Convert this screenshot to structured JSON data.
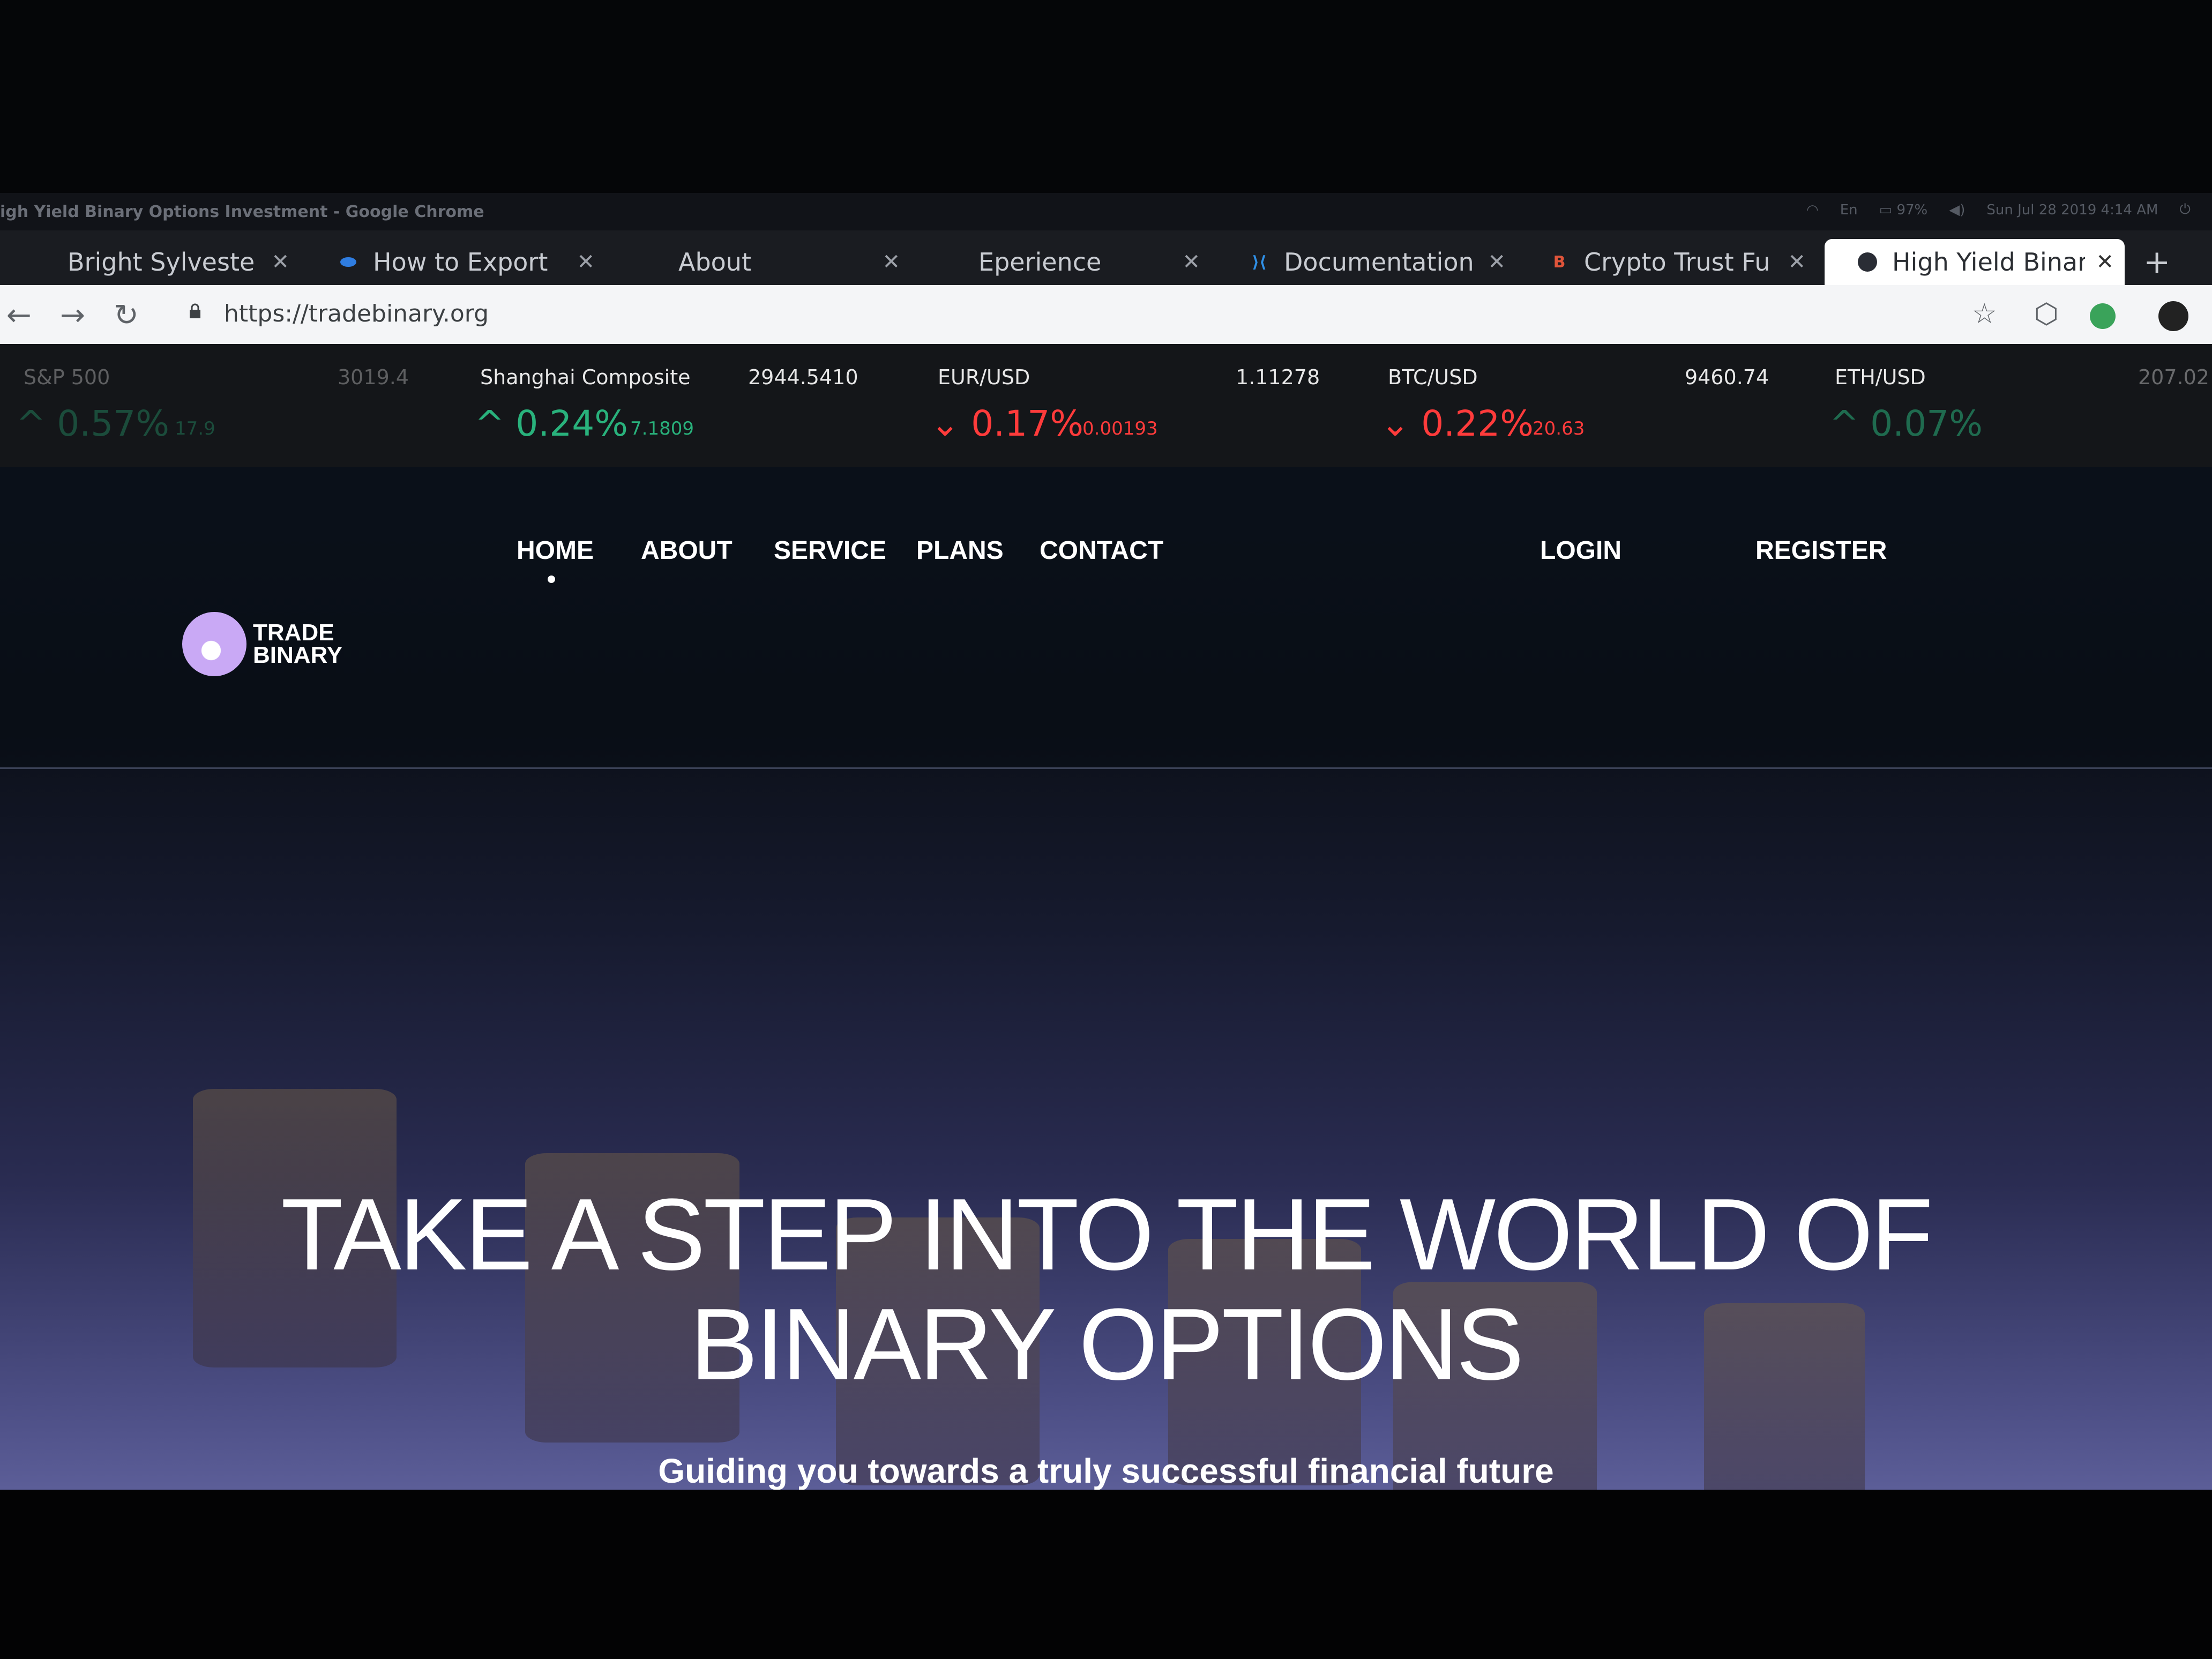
{
  "os": {
    "window_title": "igh Yield Binary Options Investment - Google Chrome",
    "clock": "Sun Jul 28 2019 4:14 AM",
    "battery": "97%"
  },
  "tabs": [
    {
      "title": "Bright Sylveste",
      "favicon": "none",
      "active": false
    },
    {
      "title": "How to Export",
      "favicon": "blue-dot",
      "active": false
    },
    {
      "title": "About",
      "favicon": "none",
      "active": false
    },
    {
      "title": "Eperience",
      "favicon": "none",
      "active": false
    },
    {
      "title": "Documentation",
      "favicon": "vscode-icon",
      "active": false
    },
    {
      "title": "Crypto Trust Fu",
      "favicon": "b-icon",
      "active": false
    },
    {
      "title": "High Yield Binar",
      "favicon": "site-icon",
      "active": true
    }
  ],
  "browser": {
    "url": "https://tradebinary.org"
  },
  "ticker": [
    {
      "symbol": "S&P 500",
      "price": "3019.4",
      "pct": "0.57%",
      "change": "17.9",
      "direction": "up"
    },
    {
      "symbol": "Shanghai Composite",
      "price": "2944.5410",
      "pct": "0.24%",
      "change": "7.1809",
      "direction": "up"
    },
    {
      "symbol": "EUR/USD",
      "price": "1.11278",
      "pct": "0.17%",
      "change": "0.00193",
      "direction": "down"
    },
    {
      "symbol": "BTC/USD",
      "price": "9460.74",
      "pct": "0.22%",
      "change": "20.63",
      "direction": "down"
    },
    {
      "symbol": "ETH/USD",
      "price": "207.02",
      "pct": "0.07%",
      "change": "",
      "direction": "up"
    }
  ],
  "nav": {
    "home": "HOME",
    "about": "ABOUT",
    "service": "SERVICE",
    "plans": "PLANS",
    "contact": "CONTACT",
    "login": "LOGIN",
    "register": "REGISTER"
  },
  "logo": {
    "line1": "TRADE",
    "line2": "BINARY"
  },
  "hero": {
    "title_line1": "TAKE A STEP INTO THE WORLD OF",
    "title_line2": "BINARY OPTIONS",
    "subtitle": "Guiding you towards a truly successful financial future"
  },
  "colors": {
    "up": "#29b27c",
    "down": "#ff3b3b",
    "chat_button": "#3aa35a",
    "logo_accent": "#c9a9f5"
  }
}
